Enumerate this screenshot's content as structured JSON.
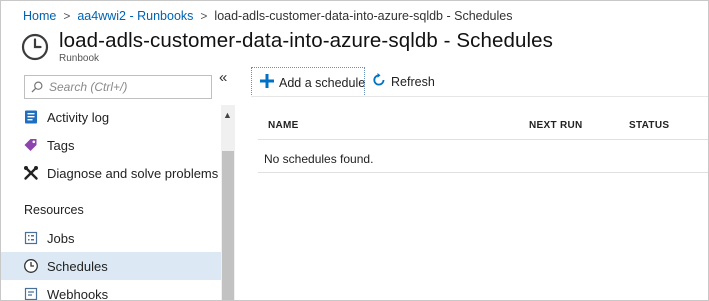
{
  "breadcrumb": {
    "items": [
      "Home",
      "aa4wwi2 - Runbooks",
      "load-adls-customer-data-into-azure-sqldb - Schedules"
    ],
    "separator": ">"
  },
  "header": {
    "title": "load-adls-customer-data-into-azure-sqldb - Schedules",
    "subtitle": "Runbook",
    "icon": "clock-icon"
  },
  "sidebar": {
    "search_placeholder": "Search (Ctrl+/)",
    "collapse_label": "«",
    "items": [
      {
        "label": "Activity log",
        "icon": "activity-log-icon"
      },
      {
        "label": "Tags",
        "icon": "tag-icon"
      },
      {
        "label": "Diagnose and solve problems",
        "icon": "wrench-icon"
      }
    ],
    "section_title": "Resources",
    "resource_items": [
      {
        "label": "Jobs",
        "icon": "jobs-icon"
      },
      {
        "label": "Schedules",
        "icon": "clock-icon",
        "active": true
      },
      {
        "label": "Webhooks",
        "icon": "webhook-icon"
      }
    ]
  },
  "toolbar": {
    "add_label": "Add a schedule",
    "refresh_label": "Refresh"
  },
  "table": {
    "columns": [
      "NAME",
      "NEXT RUN",
      "STATUS"
    ],
    "empty_message": "No schedules found."
  },
  "colors": {
    "link": "#0063b1",
    "active_bg": "#dce9f5",
    "accent": "#0072c6"
  }
}
